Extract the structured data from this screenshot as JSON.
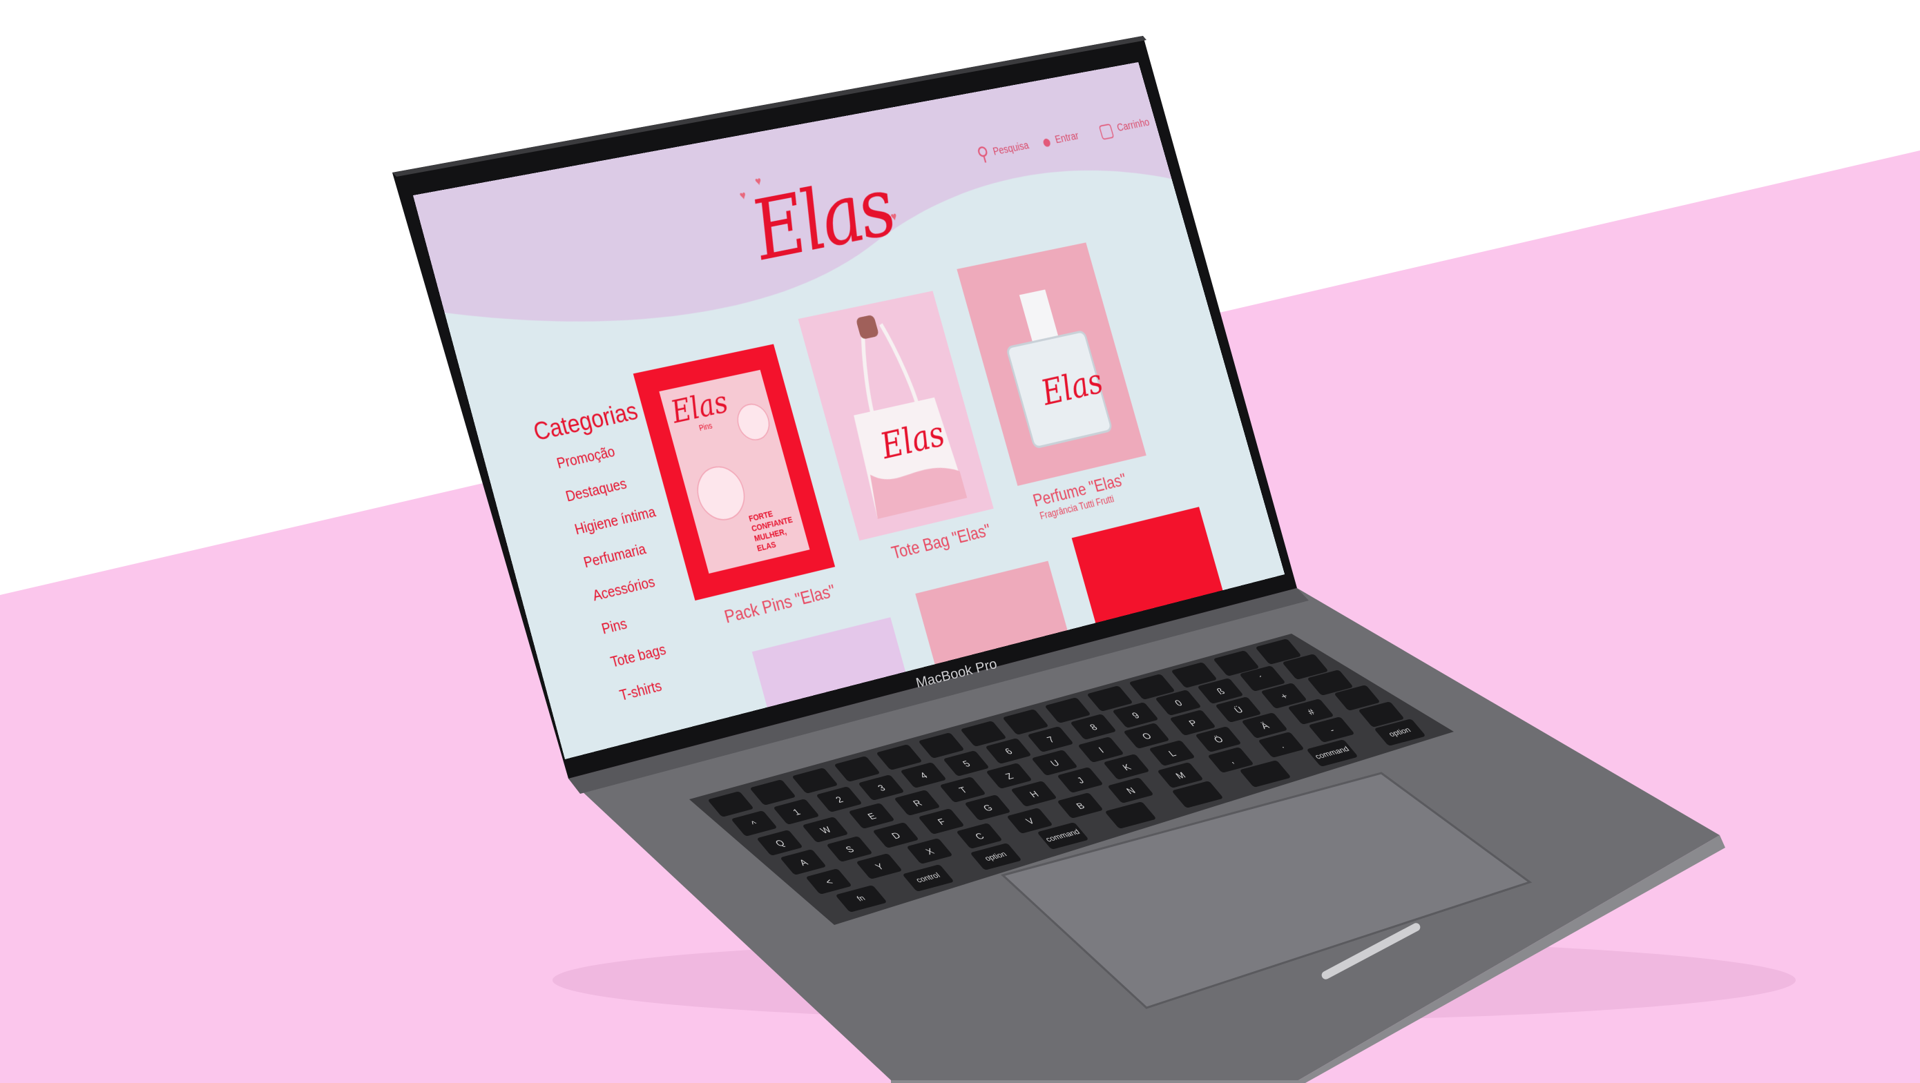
{
  "store": {
    "logo": "Elas",
    "nav": [
      {
        "icon": "search-icon",
        "label": "Pesquisa"
      },
      {
        "icon": "user-icon",
        "label": "Entrar"
      },
      {
        "icon": "bag-icon",
        "label": "Carrinho"
      }
    ]
  },
  "sidebar": {
    "title": "Categorias",
    "items": [
      "Promoção",
      "Destaques",
      "Higiene íntima",
      "Perfumaria",
      "Acessórios",
      "Pins",
      "Tote bags",
      "T-shirts"
    ]
  },
  "products": [
    {
      "title": "Pack Pins \"Elas\"",
      "subtitle": "",
      "image_logo": "Elas",
      "image_tag": "Pins",
      "image_text": "FORTE CONFIANTE MULHER, ELAS"
    },
    {
      "title": "Tote Bag \"Elas\"",
      "subtitle": "",
      "image_logo": "Elas"
    },
    {
      "title": "Perfume \"Elas\"",
      "subtitle": "Fragrância Tutti Frutti",
      "image_logo": "Elas"
    }
  ],
  "device": {
    "label": "MacBook Pro"
  },
  "keyboard": {
    "rows": [
      [
        "^",
        "1",
        "2",
        "3",
        "4",
        "5",
        "6",
        "7",
        "8",
        "9",
        "0",
        "ß",
        "´"
      ],
      [
        "Q",
        "W",
        "E",
        "R",
        "T",
        "Z",
        "U",
        "I",
        "O",
        "P",
        "Ü",
        "+"
      ],
      [
        "A",
        "S",
        "D",
        "F",
        "G",
        "H",
        "J",
        "K",
        "L",
        "Ö",
        "Ä",
        "#"
      ],
      [
        "<",
        "Y",
        "X",
        "C",
        "V",
        "B",
        "N",
        "M",
        ",",
        ".",
        "-"
      ]
    ],
    "mods_left": [
      "fn",
      "control",
      "option",
      "command"
    ],
    "mods_right": [
      "command",
      "option"
    ]
  },
  "colors": {
    "background_pink": "#fbc6ec",
    "brand_red": "#e6122d",
    "header_lilac": "#dccbe6",
    "page_bg": "#dce9ee",
    "laptop_gray": "#6f6f73"
  }
}
